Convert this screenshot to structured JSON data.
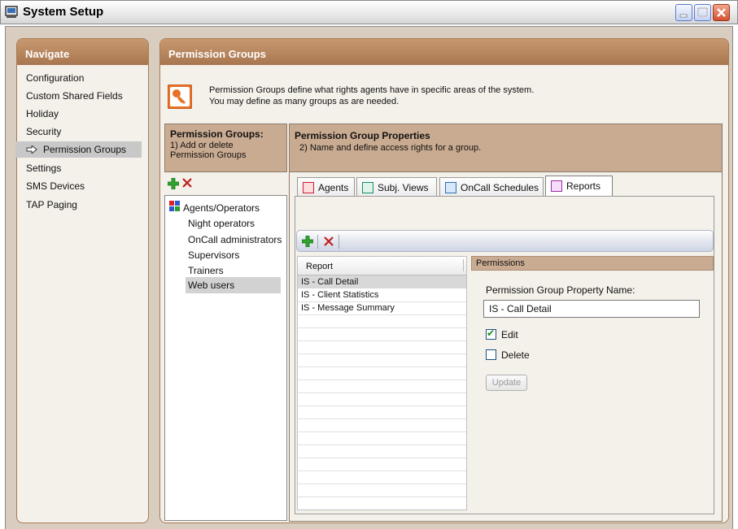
{
  "window": {
    "title": "System Setup"
  },
  "navigate": {
    "header": "Navigate",
    "items": [
      {
        "label": "Configuration"
      },
      {
        "label": "Custom Shared Fields"
      },
      {
        "label": "Holiday"
      },
      {
        "label": "Security"
      },
      {
        "label": "Permission Groups",
        "selected": true
      },
      {
        "label": "Settings"
      },
      {
        "label": "SMS Devices"
      },
      {
        "label": "TAP Paging"
      }
    ]
  },
  "main": {
    "header": "Permission Groups",
    "description": "Permission Groups define what rights agents have in specific areas of the system.  You may define as many groups as are needed."
  },
  "groups": {
    "heading": "Permission Groups:",
    "subtitle": "1) Add or delete Permission Groups",
    "items": [
      {
        "label": "Agents/Operators",
        "icon": "agents-group-icon"
      },
      {
        "label": "Night operators"
      },
      {
        "label": "OnCall administrators"
      },
      {
        "label": "Supervisors"
      },
      {
        "label": "Trainers"
      },
      {
        "label": "Web users",
        "selected": true
      }
    ]
  },
  "properties": {
    "heading": "Permission Group Properties",
    "subtitle": "2) Name and define access rights for a group.",
    "tabs": [
      {
        "label": "Agents",
        "icon": "agents-tab-icon"
      },
      {
        "label": "Subj. Views",
        "icon": "subj-views-tab-icon"
      },
      {
        "label": "OnCall Schedules",
        "icon": "oncall-tab-icon"
      },
      {
        "label": "Reports",
        "icon": "reports-tab-icon",
        "active": true
      }
    ]
  },
  "reports": {
    "column_header": "Report",
    "items": [
      {
        "label": "IS - Call Detail",
        "selected": true
      },
      {
        "label": "IS - Client Statistics"
      },
      {
        "label": "IS - Message Summary"
      }
    ]
  },
  "permissions": {
    "header": "Permissions",
    "name_label": "Permission Group Property Name:",
    "name_value": "IS - Call Detail",
    "edit_label": "Edit",
    "edit_checked": true,
    "delete_label": "Delete",
    "delete_checked": false,
    "update_label": "Update"
  },
  "colors": {
    "panel_header": "#a8764f",
    "add_icon": "#2fa52f",
    "delete_icon": "#c0201c",
    "key_icon_bg": "#e8712a"
  }
}
